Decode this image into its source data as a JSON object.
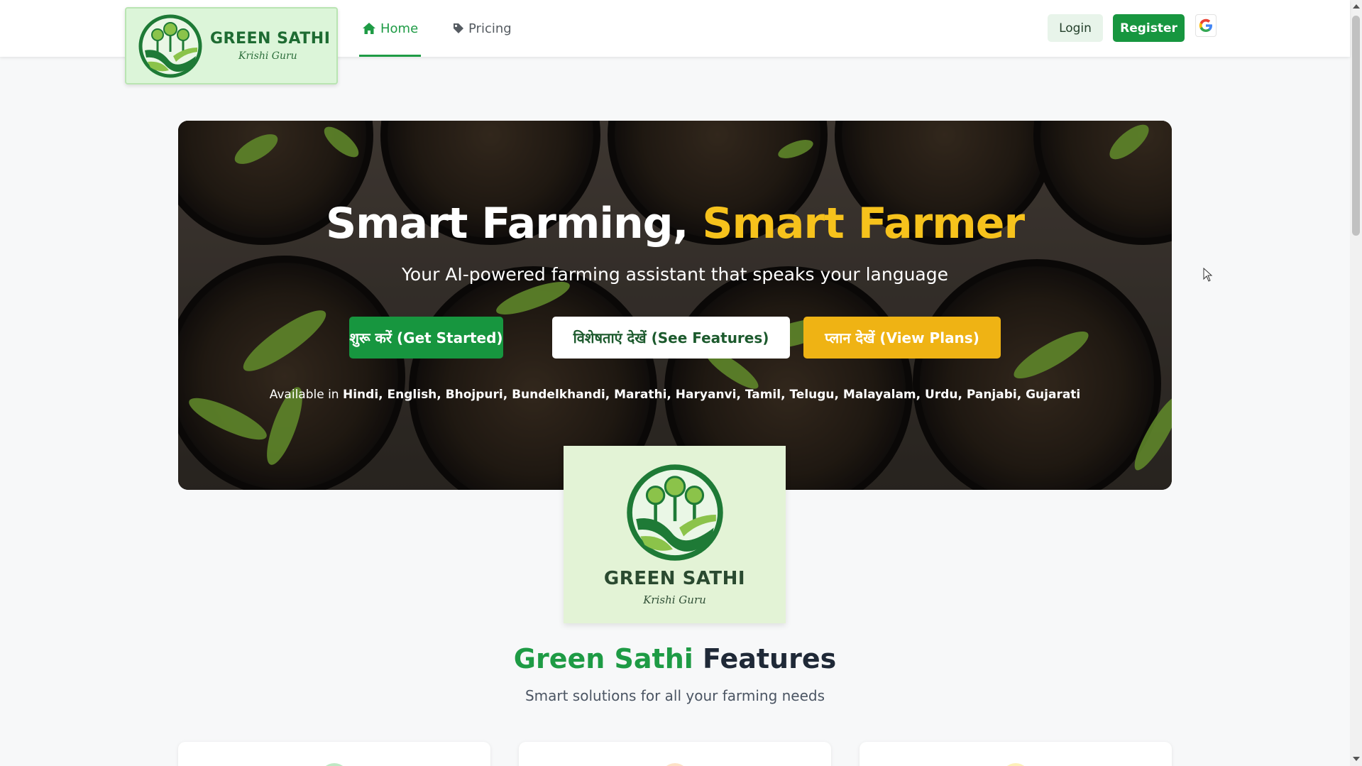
{
  "brand": {
    "name": "GREEN SATHI",
    "tagline": "Krishi Guru"
  },
  "nav": {
    "items": [
      {
        "label": "Home",
        "icon": "home-icon",
        "active": true
      },
      {
        "label": "Pricing",
        "icon": "tag-icon",
        "active": false
      }
    ],
    "login_label": "Login",
    "register_label": "Register",
    "google_icon": "google-icon"
  },
  "hero": {
    "title_part1": "Smart Farming, ",
    "title_part2": "Smart Farmer",
    "subtitle": "Your AI-powered farming assistant that speaks your language",
    "buttons": {
      "get_started": "शुरू करें (Get Started)",
      "see_features": "विशेषताएं देखें (See Features)",
      "view_plans": "प्लान देखें (View Plans)"
    },
    "languages_prefix": "Available in ",
    "languages": "Hindi, English, Bhojpuri, Bundelkhandi, Marathi, Haryanvi, Tamil, Telugu, Malayalam, Urdu, Panjabi, Gujarati"
  },
  "center_logo": {
    "title": "GREEN SATHI",
    "tagline": "Krishi Guru"
  },
  "features": {
    "heading_highlight": "Green Sathi",
    "heading_rest": " Features",
    "subtitle": "Smart solutions for all your farming needs"
  },
  "colors": {
    "primary_green": "#17963f",
    "accent_yellow": "#f6c21c",
    "button_yellow": "#efb314",
    "logo_bg": "#dcf5d9"
  }
}
